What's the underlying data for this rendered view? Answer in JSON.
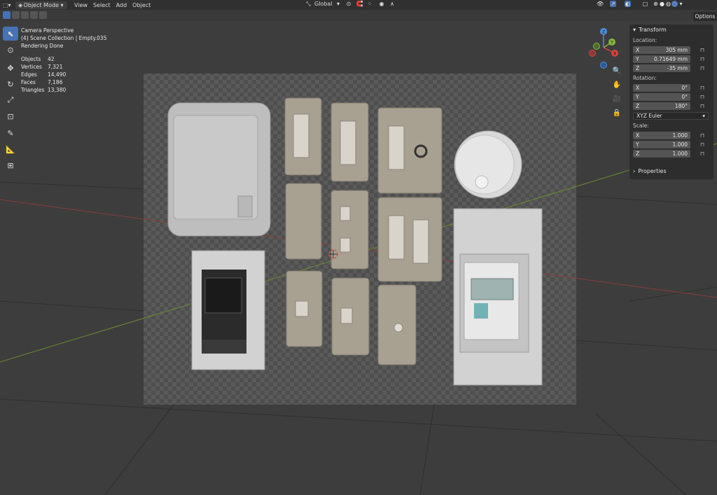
{
  "topbar": {
    "mode": "Object Mode",
    "menus": [
      "View",
      "Select",
      "Add",
      "Object"
    ],
    "transform_orientation": "Global"
  },
  "options_label": "Options",
  "viewport_info": {
    "camera": "Camera Perspective",
    "collection": "(4) Scene Collection | Empty.035",
    "status": "Rendering Done",
    "stats": [
      {
        "label": "Objects",
        "value": "42"
      },
      {
        "label": "Vertices",
        "value": "7,321"
      },
      {
        "label": "Edges",
        "value": "14,490"
      },
      {
        "label": "Faces",
        "value": "7,186"
      },
      {
        "label": "Triangles",
        "value": "13,380"
      }
    ]
  },
  "gizmo": {
    "z": "Z",
    "y": "Y",
    "x": "X"
  },
  "transform_panel": {
    "title": "Transform",
    "location_label": "Location:",
    "location": [
      {
        "axis": "X",
        "value": "305 mm"
      },
      {
        "axis": "Y",
        "value": "0.71649 mm"
      },
      {
        "axis": "Z",
        "value": "-35 mm"
      }
    ],
    "rotation_label": "Rotation:",
    "rotation": [
      {
        "axis": "X",
        "value": "0°"
      },
      {
        "axis": "Y",
        "value": "0°"
      },
      {
        "axis": "Z",
        "value": "180°"
      }
    ],
    "rotation_mode": "XYZ Euler",
    "scale_label": "Scale:",
    "scale": [
      {
        "axis": "X",
        "value": "1.000"
      },
      {
        "axis": "Y",
        "value": "1.000"
      },
      {
        "axis": "Z",
        "value": "1.000"
      }
    ]
  },
  "properties_panel": {
    "title": "Properties"
  },
  "colors": {
    "accent": "#4772b3",
    "x_axis": "#d2453f",
    "y_axis": "#86b53a",
    "z_axis": "#4a8fe0"
  }
}
